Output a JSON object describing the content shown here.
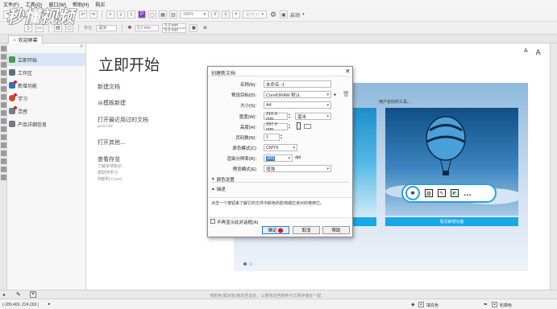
{
  "menubar": {
    "items": [
      "文件(F)",
      "工具(O)",
      "窗口(W)",
      "帮助(H)",
      "购买"
    ]
  },
  "toolbar": {
    "zoom_value": "100%",
    "snap_label": "贴齐(T)",
    "launch_label": "启动",
    "unit_label": "单位:",
    "unit_value": "毫米",
    "nudge_value": "0.1 mm",
    "dup_x": "5.0 mm",
    "dup_y": "5.0 mm"
  },
  "tabs": {
    "welcome": "欢迎屏幕"
  },
  "sidebar": {
    "items": [
      {
        "label": "立即开始",
        "active": true,
        "badge": false
      },
      {
        "label": "工作区",
        "active": false,
        "badge": false
      },
      {
        "label": "新增功能",
        "active": false,
        "badge": true
      },
      {
        "label": "学习",
        "active": false,
        "badge": true
      },
      {
        "label": "灵感",
        "active": false,
        "badge": true
      },
      {
        "label": "产品详细信息",
        "active": false,
        "badge": false
      }
    ]
  },
  "welcome": {
    "title": "立即开始",
    "new_doc": "新建文档",
    "from_template": "从模板新建",
    "open_recent": "打开最近用过的文档",
    "recent_file": "psd.cdr",
    "open_other": "打开其他...",
    "view_history": "查看存览",
    "history_1": "了解本地知识",
    "history_2": "帮助你学习",
    "history_3": "阿斯利 Corel",
    "preview_caption": "用户友好的工具。",
    "new_features_button": "看见新增功能",
    "zoom_icons": [
      "A",
      "A"
    ]
  },
  "dialog": {
    "title": "创建新文档",
    "name_label": "名称(N):",
    "name_value": "未命名 -1",
    "preset_label": "预设目标(D):",
    "preset_value": "CorelDRAW 默认",
    "size_label": "大小(S):",
    "size_value": "A4",
    "width_label": "宽度(W):",
    "width_value": "210.0 mm",
    "width_unit": "毫米",
    "height_label": "高度(H):",
    "height_value": "297.0 mm",
    "pages_label": "页码数(N):",
    "pages_value": "1",
    "color_mode_label": "原色模式(C)",
    "color_mode_value": "CMYK",
    "resolution_label": "渲染分辨率(R):",
    "resolution_value": "300",
    "resolution_unit": "dpi",
    "preview_mode_label": "预览模式(E)",
    "preview_mode_value": "增强",
    "color_settings": "颜色设置",
    "description_header": "描述",
    "description_text": "点击一个按钮来了解它的文件中颜色的影响或应该对的使用它。",
    "dont_show": "不再显示此对话框(A)",
    "ok": "确定",
    "cancel": "取消",
    "help": "帮助"
  },
  "statusbar": {
    "coords": "(-289.469, 224.269 )",
    "hint": "将颜色(或对象)拖动至此处，以便将这些颜色与文档存储在一起",
    "fill_label": "填充色",
    "outline_label": "轮廓色"
  },
  "watermark": {
    "text": "秒懂视频"
  },
  "colors": {
    "accent": "#17a8e8",
    "selection": "#d8e6f5",
    "badge": "#e02020"
  }
}
